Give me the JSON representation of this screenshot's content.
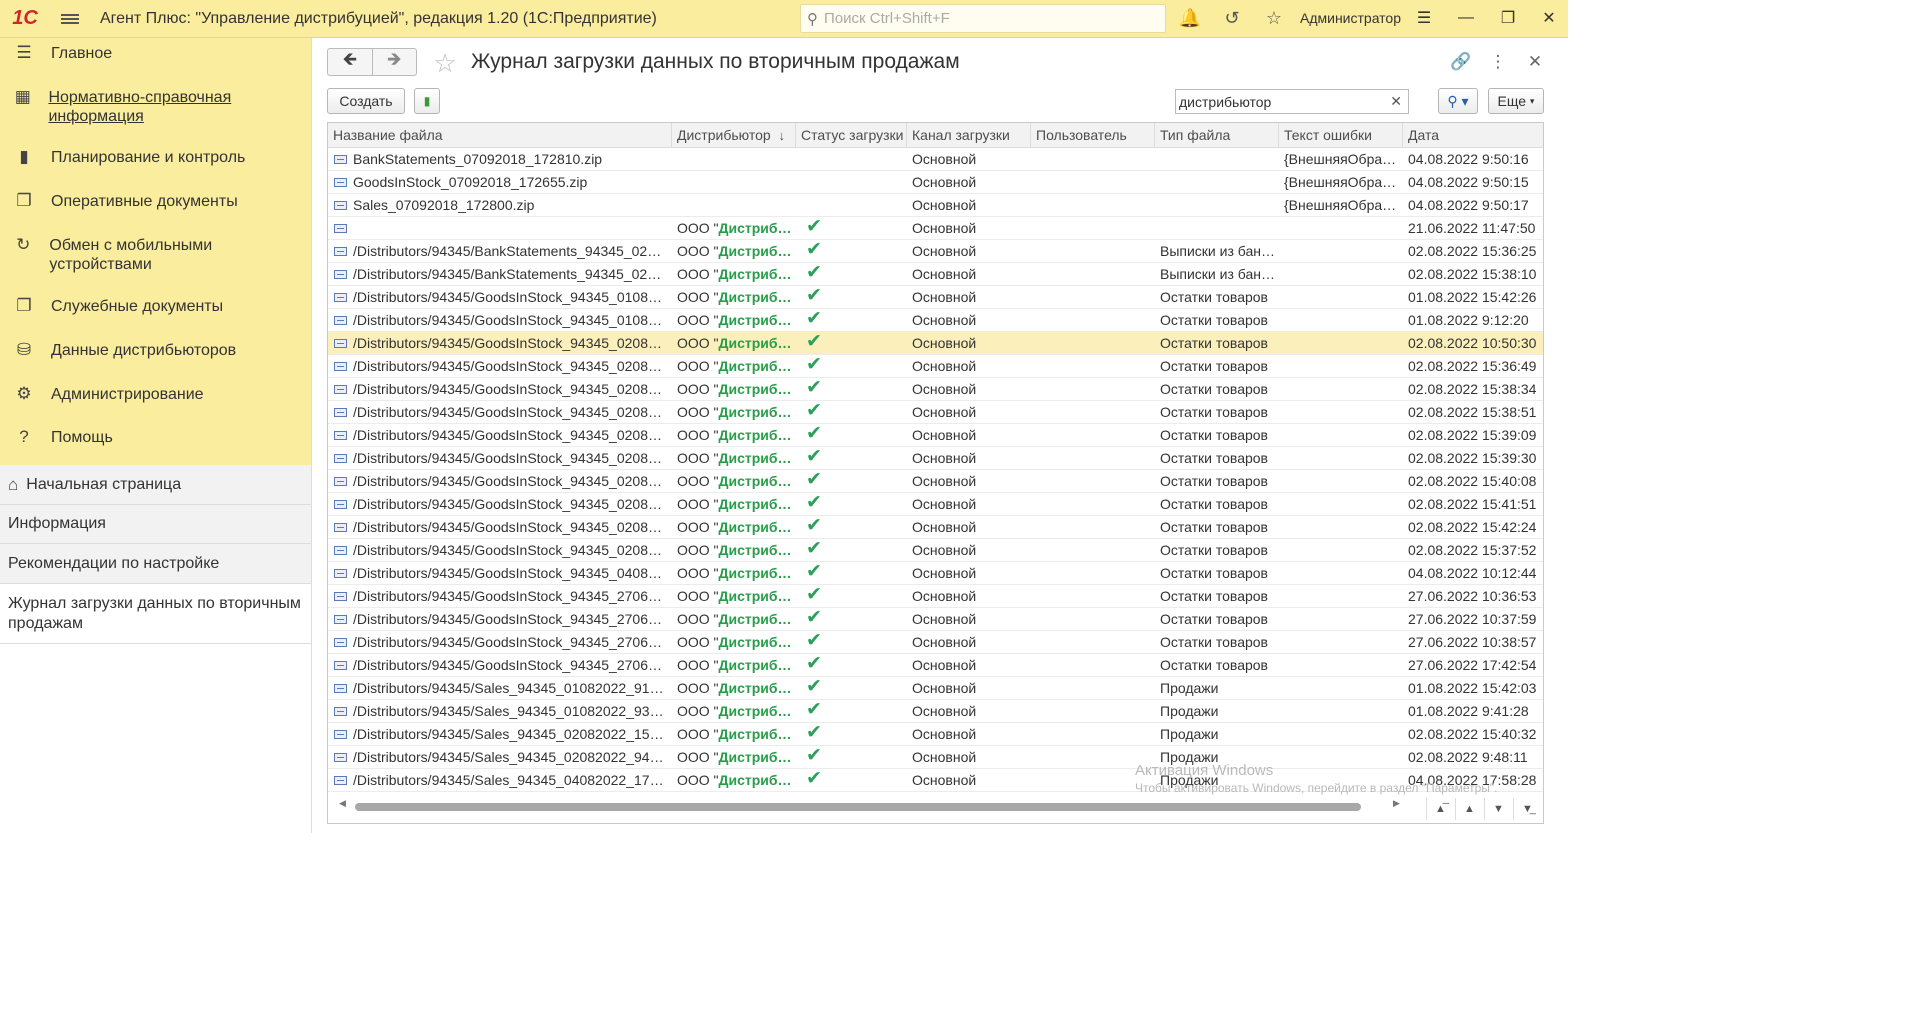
{
  "app": {
    "logo": "1С",
    "title": "Агент Плюс: \"Управление дистрибуцией\", редакция 1.20  (1С:Предприятие)",
    "search_placeholder": "Поиск Ctrl+Shift+F",
    "user": "Администратор"
  },
  "sections": [
    {
      "label": "Главное",
      "icon": "menu-lines-icon"
    },
    {
      "label": "Нормативно-справочная информация",
      "icon": "bars-icon"
    },
    {
      "label": "Планирование и контроль",
      "icon": "chart-icon"
    },
    {
      "label": "Оперативные документы",
      "icon": "documents-icon"
    },
    {
      "label": "Обмен с мобильными устройствами",
      "icon": "sync-icon"
    },
    {
      "label": "Служебные документы",
      "icon": "service-docs-icon"
    },
    {
      "label": "Данные дистрибьюторов",
      "icon": "distributor-data-icon"
    },
    {
      "label": "Администрирование",
      "icon": "gear-icon"
    },
    {
      "label": "Помощь",
      "icon": "help-icon"
    }
  ],
  "open_windows": [
    {
      "label": "Начальная страница"
    },
    {
      "label": "Информация"
    },
    {
      "label": "Рекомендации по настройке"
    },
    {
      "label": "Журнал загрузки данных по вторичным продажам"
    }
  ],
  "form": {
    "title": "Журнал загрузки данных по вторичным продажам",
    "create_label": "Создать",
    "search_value": "дистрибьютор",
    "more_label": "Еще"
  },
  "table": {
    "columns": [
      "Название файла",
      "Дистрибьютор",
      "Статус загрузки",
      "Канал загрузки",
      "Пользователь",
      "Тип файла",
      "Текст ошибки",
      "Дата"
    ],
    "rows": [
      {
        "file": "BankStatements_07092018_172810.zip",
        "dist_prefix": "",
        "dist_name": "",
        "ok": false,
        "channel": "Основной",
        "user": "",
        "type": "",
        "error": "{ВнешняяОбраб…",
        "date": "04.08.2022 9:50:16"
      },
      {
        "file": "GoodsInStock_07092018_172655.zip",
        "dist_prefix": "",
        "dist_name": "",
        "ok": false,
        "channel": "Основной",
        "user": "",
        "type": "",
        "error": "{ВнешняяОбраб…",
        "date": "04.08.2022 9:50:15"
      },
      {
        "file": "Sales_07092018_172800.zip",
        "dist_prefix": "",
        "dist_name": "",
        "ok": false,
        "channel": "Основной",
        "user": "",
        "type": "",
        "error": "{ВнешняяОбраб…",
        "date": "04.08.2022 9:50:17"
      },
      {
        "file": "",
        "dist_prefix": "ООО \"",
        "dist_name": "Дистриб…",
        "ok": true,
        "channel": "Основной",
        "user": "",
        "type": "",
        "error": "",
        "date": "21.06.2022 11:47:50"
      },
      {
        "file": "/Distributors/94345/BankStatements_94345_02082…",
        "dist_prefix": "ООО \"",
        "dist_name": "Дистриб…",
        "ok": true,
        "channel": "Основной",
        "user": "",
        "type": "Выписки из банка",
        "error": "",
        "date": "02.08.2022 15:36:25"
      },
      {
        "file": "/Distributors/94345/BankStatements_94345_02082…",
        "dist_prefix": "ООО \"",
        "dist_name": "Дистриб…",
        "ok": true,
        "channel": "Основной",
        "user": "",
        "type": "Выписки из банка",
        "error": "",
        "date": "02.08.2022 15:38:10"
      },
      {
        "file": "/Distributors/94345/GoodsInStock_94345_0108202…",
        "dist_prefix": "ООО \"",
        "dist_name": "Дистриб…",
        "ok": true,
        "channel": "Основной",
        "user": "",
        "type": "Остатки товаров",
        "error": "",
        "date": "01.08.2022 15:42:26"
      },
      {
        "file": "/Distributors/94345/GoodsInStock_94345_0108202…",
        "dist_prefix": "ООО \"",
        "dist_name": "Дистриб…",
        "ok": true,
        "channel": "Основной",
        "user": "",
        "type": "Остатки товаров",
        "error": "",
        "date": "01.08.2022 9:12:20"
      },
      {
        "file": "/Distributors/94345/GoodsInStock_94345_0208202…",
        "dist_prefix": "ООО \"",
        "dist_name": "Дистриб…",
        "ok": true,
        "channel": "Основной",
        "user": "",
        "type": "Остатки товаров",
        "error": "",
        "date": "02.08.2022 10:50:30",
        "selected": true
      },
      {
        "file": "/Distributors/94345/GoodsInStock_94345_0208202…",
        "dist_prefix": "ООО \"",
        "dist_name": "Дистриб…",
        "ok": true,
        "channel": "Основной",
        "user": "",
        "type": "Остатки товаров",
        "error": "",
        "date": "02.08.2022 15:36:49"
      },
      {
        "file": "/Distributors/94345/GoodsInStock_94345_0208202…",
        "dist_prefix": "ООО \"",
        "dist_name": "Дистриб…",
        "ok": true,
        "channel": "Основной",
        "user": "",
        "type": "Остатки товаров",
        "error": "",
        "date": "02.08.2022 15:38:34"
      },
      {
        "file": "/Distributors/94345/GoodsInStock_94345_0208202…",
        "dist_prefix": "ООО \"",
        "dist_name": "Дистриб…",
        "ok": true,
        "channel": "Основной",
        "user": "",
        "type": "Остатки товаров",
        "error": "",
        "date": "02.08.2022 15:38:51"
      },
      {
        "file": "/Distributors/94345/GoodsInStock_94345_0208202…",
        "dist_prefix": "ООО \"",
        "dist_name": "Дистриб…",
        "ok": true,
        "channel": "Основной",
        "user": "",
        "type": "Остатки товаров",
        "error": "",
        "date": "02.08.2022 15:39:09"
      },
      {
        "file": "/Distributors/94345/GoodsInStock_94345_0208202…",
        "dist_prefix": "ООО \"",
        "dist_name": "Дистриб…",
        "ok": true,
        "channel": "Основной",
        "user": "",
        "type": "Остатки товаров",
        "error": "",
        "date": "02.08.2022 15:39:30"
      },
      {
        "file": "/Distributors/94345/GoodsInStock_94345_0208202…",
        "dist_prefix": "ООО \"",
        "dist_name": "Дистриб…",
        "ok": true,
        "channel": "Основной",
        "user": "",
        "type": "Остатки товаров",
        "error": "",
        "date": "02.08.2022 15:40:08"
      },
      {
        "file": "/Distributors/94345/GoodsInStock_94345_0208202…",
        "dist_prefix": "ООО \"",
        "dist_name": "Дистриб…",
        "ok": true,
        "channel": "Основной",
        "user": "",
        "type": "Остатки товаров",
        "error": "",
        "date": "02.08.2022 15:41:51"
      },
      {
        "file": "/Distributors/94345/GoodsInStock_94345_0208202…",
        "dist_prefix": "ООО \"",
        "dist_name": "Дистриб…",
        "ok": true,
        "channel": "Основной",
        "user": "",
        "type": "Остатки товаров",
        "error": "",
        "date": "02.08.2022 15:42:24"
      },
      {
        "file": "/Distributors/94345/GoodsInStock_94345_0208202…",
        "dist_prefix": "ООО \"",
        "dist_name": "Дистриб…",
        "ok": true,
        "channel": "Основной",
        "user": "",
        "type": "Остатки товаров",
        "error": "",
        "date": "02.08.2022 15:37:52"
      },
      {
        "file": "/Distributors/94345/GoodsInStock_94345_0408202…",
        "dist_prefix": "ООО \"",
        "dist_name": "Дистриб…",
        "ok": true,
        "channel": "Основной",
        "user": "",
        "type": "Остатки товаров",
        "error": "",
        "date": "04.08.2022 10:12:44"
      },
      {
        "file": "/Distributors/94345/GoodsInStock_94345_2706202…",
        "dist_prefix": "ООО \"",
        "dist_name": "Дистриб…",
        "ok": true,
        "channel": "Основной",
        "user": "",
        "type": "Остатки товаров",
        "error": "",
        "date": "27.06.2022 10:36:53"
      },
      {
        "file": "/Distributors/94345/GoodsInStock_94345_2706202…",
        "dist_prefix": "ООО \"",
        "dist_name": "Дистриб…",
        "ok": true,
        "channel": "Основной",
        "user": "",
        "type": "Остатки товаров",
        "error": "",
        "date": "27.06.2022 10:37:59"
      },
      {
        "file": "/Distributors/94345/GoodsInStock_94345_2706202…",
        "dist_prefix": "ООО \"",
        "dist_name": "Дистриб…",
        "ok": true,
        "channel": "Основной",
        "user": "",
        "type": "Остатки товаров",
        "error": "",
        "date": "27.06.2022 10:38:57"
      },
      {
        "file": "/Distributors/94345/GoodsInStock_94345_2706202…",
        "dist_prefix": "ООО \"",
        "dist_name": "Дистриб…",
        "ok": true,
        "channel": "Основной",
        "user": "",
        "type": "Остатки товаров",
        "error": "",
        "date": "27.06.2022 17:42:54"
      },
      {
        "file": "/Distributors/94345/Sales_94345_01082022_91029…",
        "dist_prefix": "ООО \"",
        "dist_name": "Дистриб…",
        "ok": true,
        "channel": "Основной",
        "user": "",
        "type": "Продажи",
        "error": "",
        "date": "01.08.2022 15:42:03"
      },
      {
        "file": "/Distributors/94345/Sales_94345_01082022_93641…",
        "dist_prefix": "ООО \"",
        "dist_name": "Дистриб…",
        "ok": true,
        "channel": "Основной",
        "user": "",
        "type": "Продажи",
        "error": "",
        "date": "01.08.2022 9:41:28"
      },
      {
        "file": "/Distributors/94345/Sales_94345_02082022_15325…",
        "dist_prefix": "ООО \"",
        "dist_name": "Дистриб…",
        "ok": true,
        "channel": "Основной",
        "user": "",
        "type": "Продажи",
        "error": "",
        "date": "02.08.2022 15:40:32"
      },
      {
        "file": "/Distributors/94345/Sales_94345_02082022_94710…",
        "dist_prefix": "ООО \"",
        "dist_name": "Дистриб…",
        "ok": true,
        "channel": "Основной",
        "user": "",
        "type": "Продажи",
        "error": "",
        "date": "02.08.2022 9:48:11"
      },
      {
        "file": "/Distributors/94345/Sales_94345_04082022_17571…",
        "dist_prefix": "ООО \"",
        "dist_name": "Дистриб…",
        "ok": true,
        "channel": "Основной",
        "user": "",
        "type": "Продажи",
        "error": "",
        "date": "04.08.2022 17:58:28"
      }
    ]
  },
  "watermark": {
    "line1": "Активация Windows",
    "line2": "Чтобы активировать Windows, перейдите в раздел \"Параметры\"."
  }
}
